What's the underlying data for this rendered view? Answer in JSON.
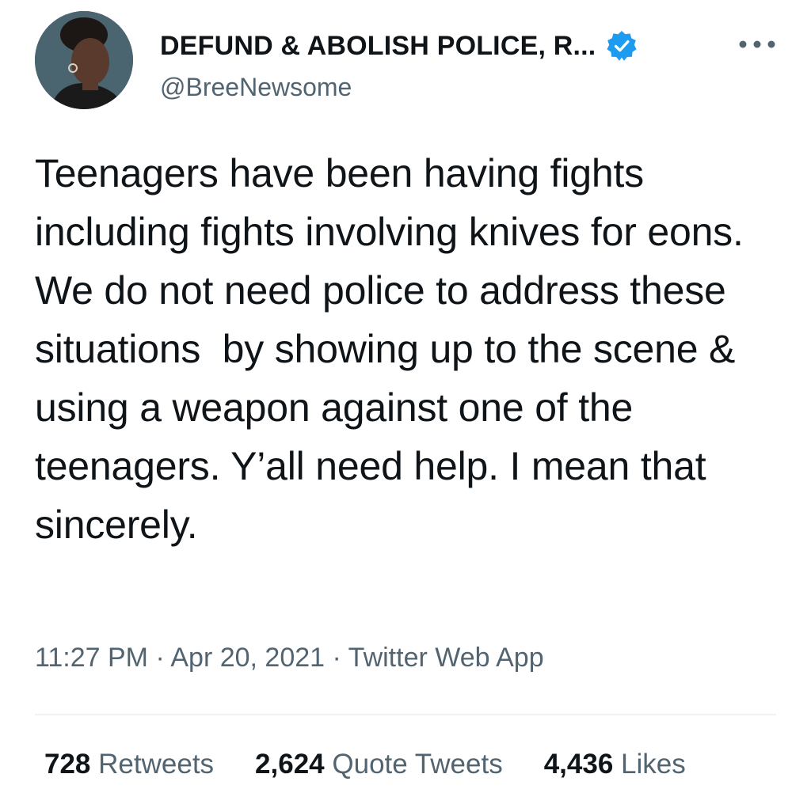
{
  "author": {
    "display_name": "DEFUND & ABOLISH POLICE, R...",
    "handle": "@BreeNewsome",
    "verified": true,
    "avatar_icon": "profile-photo",
    "verified_icon": "verified-badge-icon"
  },
  "tweet": {
    "text": "Teenagers have been having fights including fights involving knives for eons. We do not need police to address these situations  by showing up to the scene & using a weapon against one of the teenagers. Y’all need help. I mean that sincerely.",
    "time": "11:27 PM",
    "date": "Apr 20, 2021",
    "source": "Twitter Web App",
    "separator": " · "
  },
  "stats": {
    "retweets_count": "728",
    "retweets_label": "Retweets",
    "quote_tweets_count": "2,624",
    "quote_tweets_label": "Quote Tweets",
    "likes_count": "4,436",
    "likes_label": "Likes"
  },
  "colors": {
    "text_primary": "#0f1419",
    "text_secondary": "#536471",
    "verified_blue": "#1d9bf0",
    "divider": "#eff3f4"
  }
}
